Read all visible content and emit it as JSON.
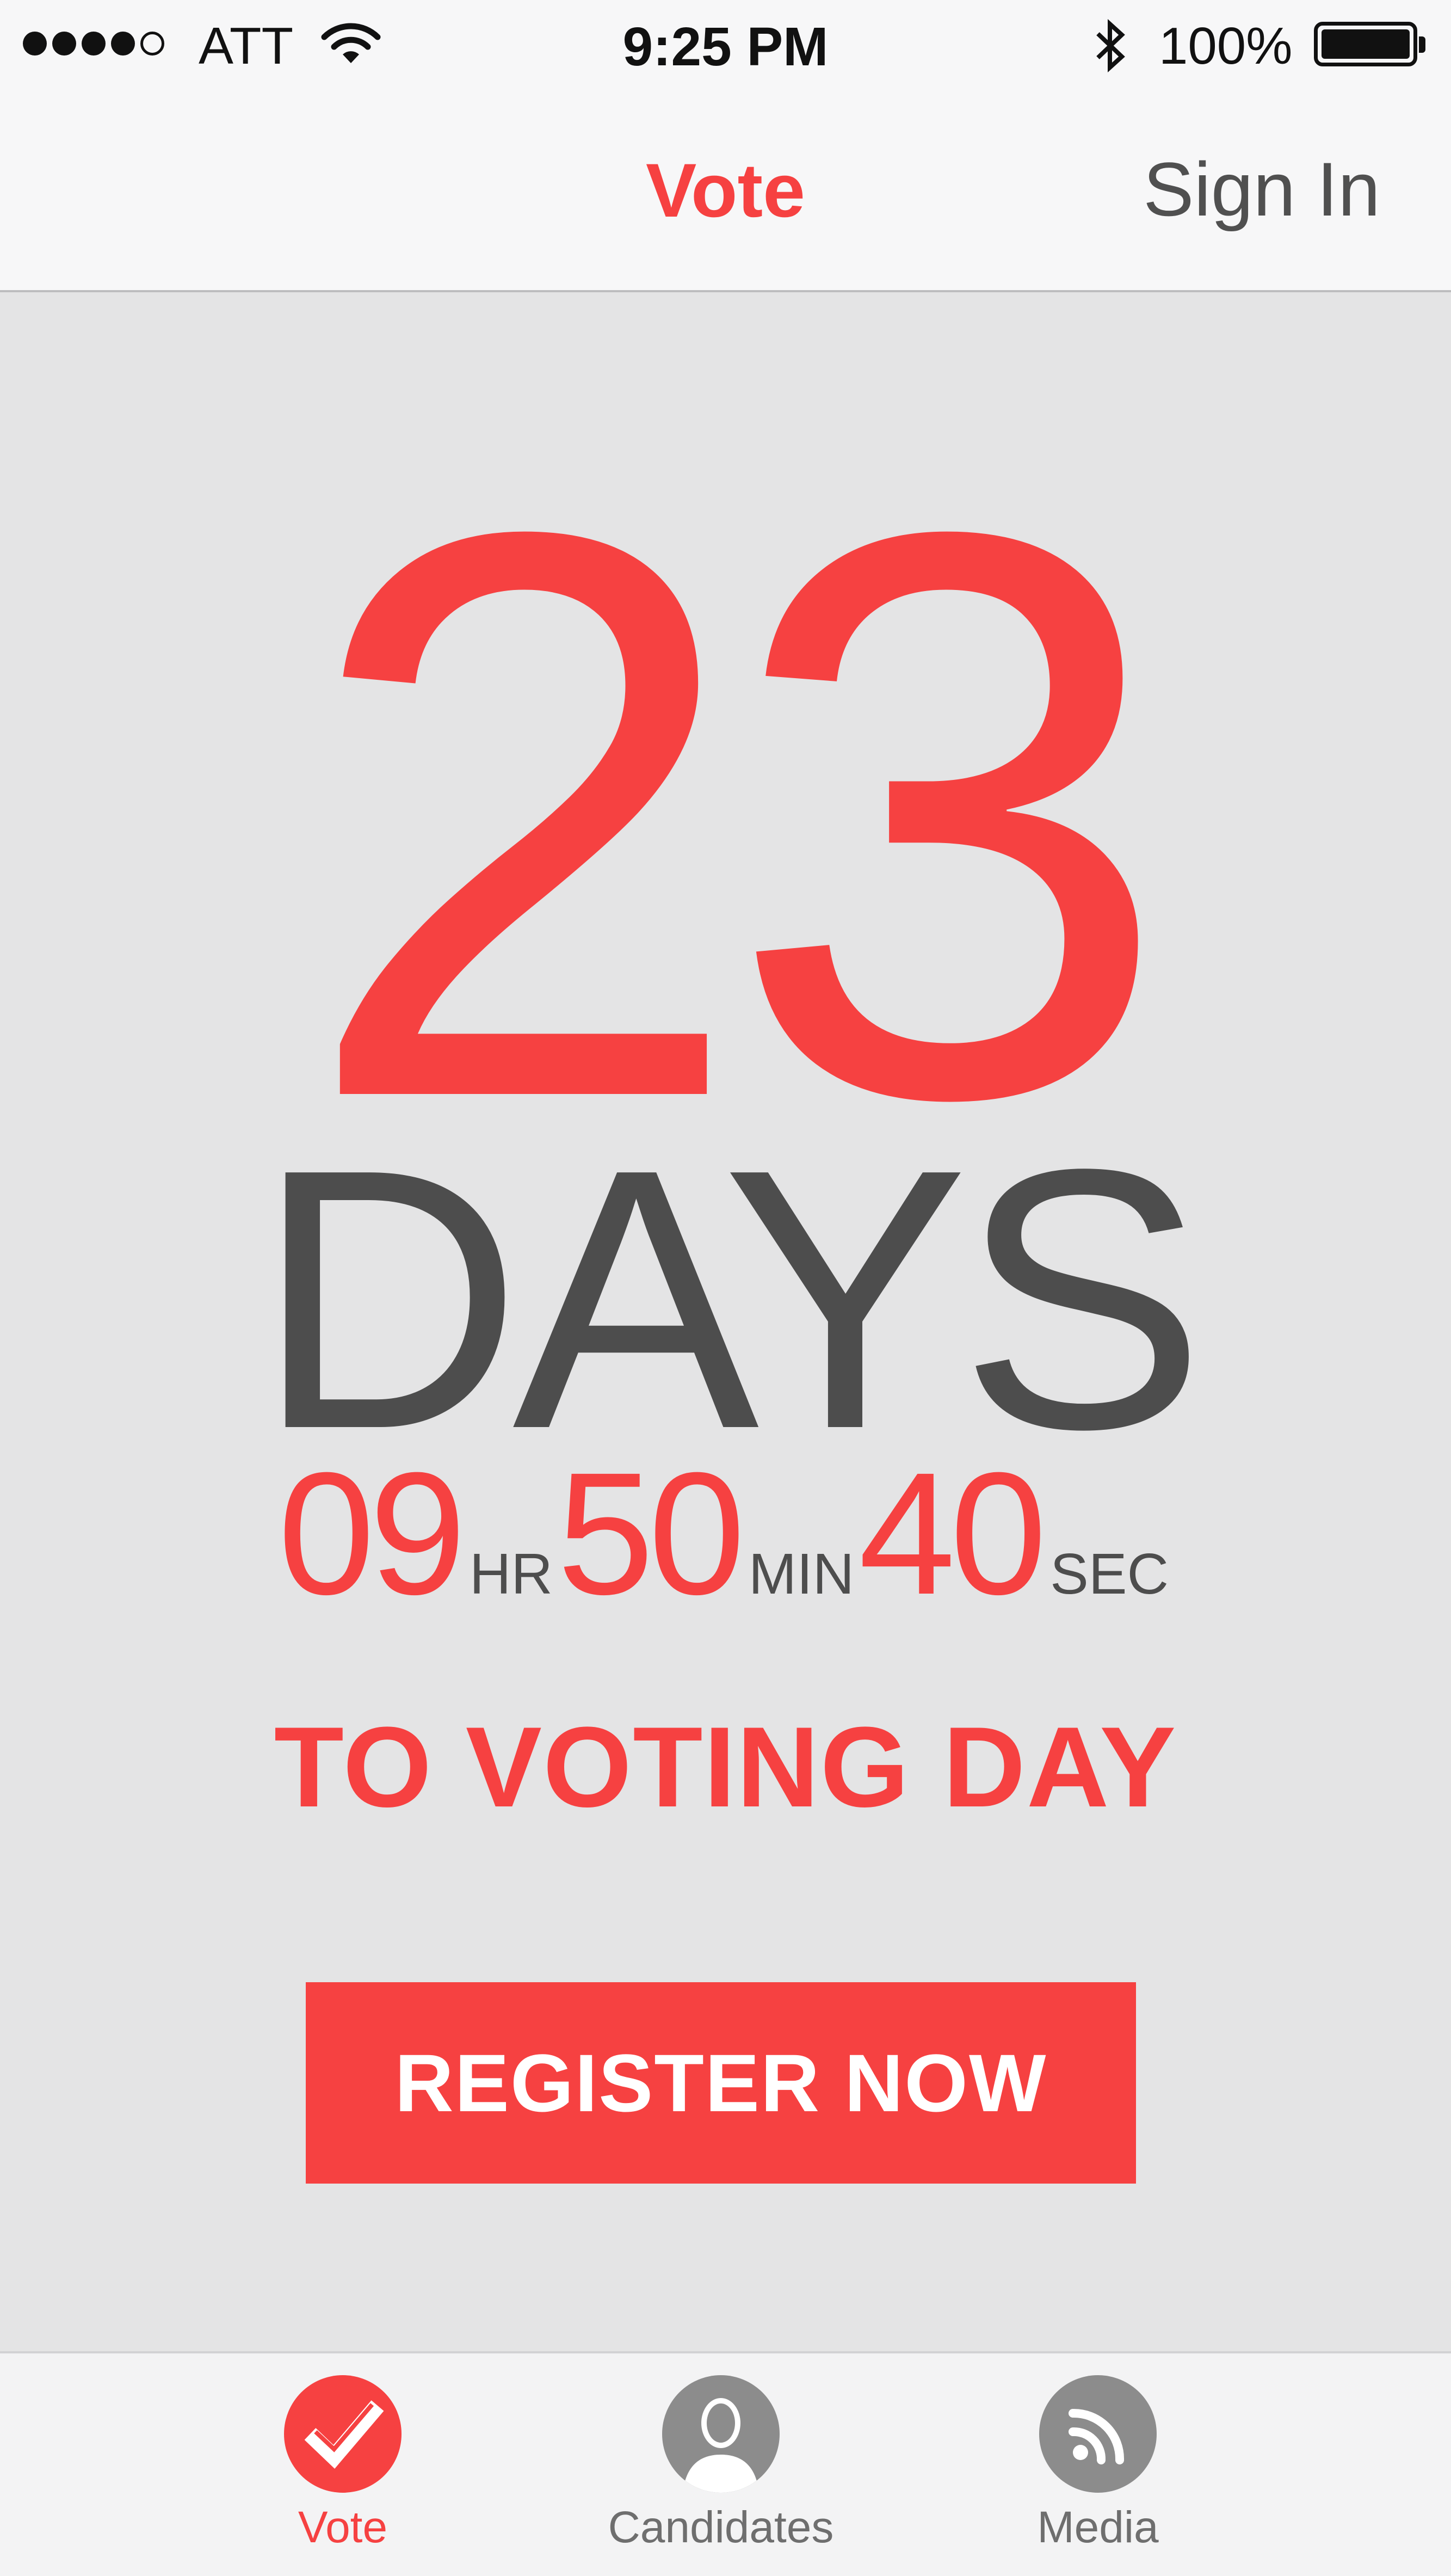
{
  "status_bar": {
    "carrier": "ATT",
    "time": "9:25 PM",
    "battery_percent": "100%",
    "signal_bars_filled": 4,
    "signal_bars_total": 5
  },
  "nav": {
    "title": "Vote",
    "sign_in": "Sign In"
  },
  "countdown": {
    "days_value": "23",
    "days_label": "DAYS",
    "hours_value": "09",
    "hours_unit": "HR",
    "minutes_value": "50",
    "minutes_unit": "MIN",
    "seconds_value": "40",
    "seconds_unit": "SEC",
    "caption": "TO VOTING DAY"
  },
  "actions": {
    "register_label": "REGISTER NOW"
  },
  "tabs": [
    {
      "label": "Vote",
      "icon": "checkmark-icon",
      "active": true
    },
    {
      "label": "Candidates",
      "icon": "person-icon",
      "active": false
    },
    {
      "label": "Media",
      "icon": "rss-feed-icon",
      "active": false
    }
  ],
  "colors": {
    "accent": "#f64141",
    "text_dark": "#4d4d4d",
    "background": "#e4e4e5",
    "bar_background": "#f7f7f8",
    "inactive_tab": "#8c8c8c"
  }
}
